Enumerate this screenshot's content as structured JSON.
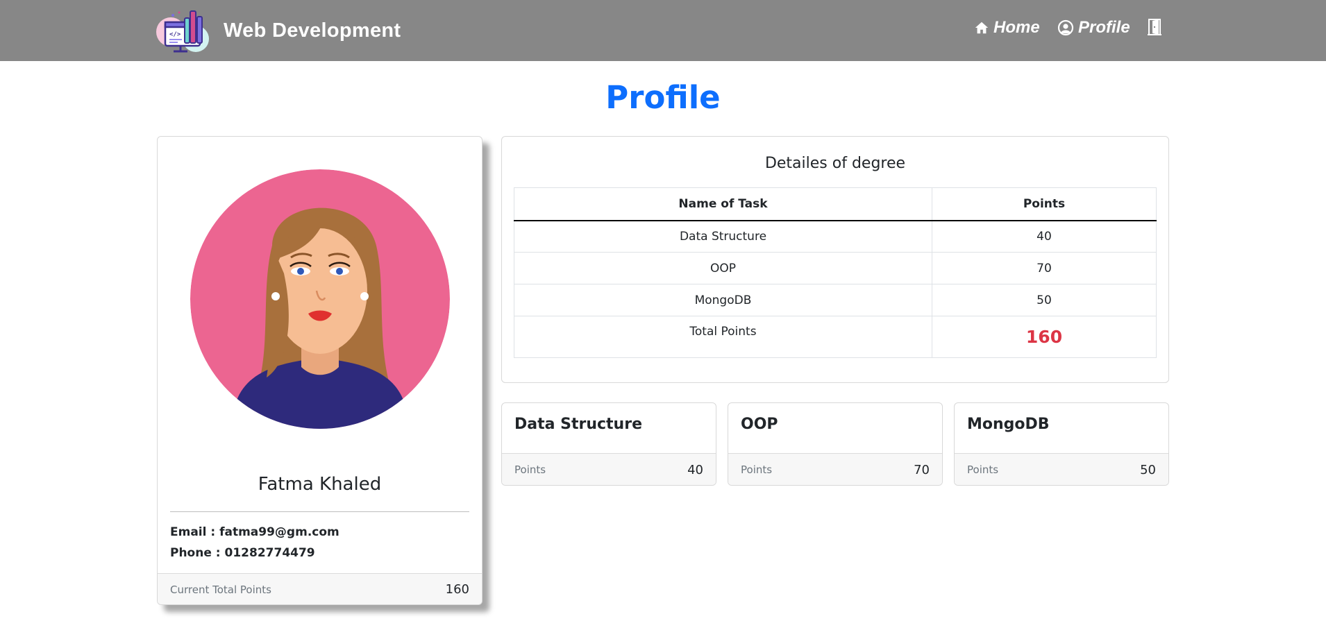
{
  "navbar": {
    "brand": "Web Development",
    "links": [
      {
        "label": "Home",
        "icon": "home-icon"
      },
      {
        "label": "Profile",
        "icon": "user-circle-icon"
      },
      {
        "label": "",
        "icon": "door-exit-icon"
      }
    ]
  },
  "page": {
    "title": "Profile"
  },
  "profile": {
    "name": "Fatma Khaled",
    "email_label": "Email : ",
    "email": "fatma99@gm.com",
    "phone_label": "Phone : ",
    "phone": "01282774479",
    "footer_label": "Current Total Points",
    "footer_value": "160"
  },
  "degree": {
    "title": "Detailes of degree",
    "columns": [
      "Name of Task",
      "Points"
    ],
    "rows": [
      {
        "task": "Data Structure",
        "points": "40"
      },
      {
        "task": "OOP",
        "points": "70"
      },
      {
        "task": "MongoDB",
        "points": "50"
      }
    ],
    "total_label": "Total Points",
    "total_value": "160"
  },
  "tasks": [
    {
      "title": "Data Structure",
      "label": "Points",
      "value": "40"
    },
    {
      "title": "OOP",
      "label": "Points",
      "value": "70"
    },
    {
      "title": "MongoDB",
      "label": "Points",
      "value": "50"
    }
  ],
  "colors": {
    "navbar": "#878787",
    "title": "#0d6efd",
    "total_highlight": "#dc3545",
    "avatar_background": "#ec6591"
  }
}
